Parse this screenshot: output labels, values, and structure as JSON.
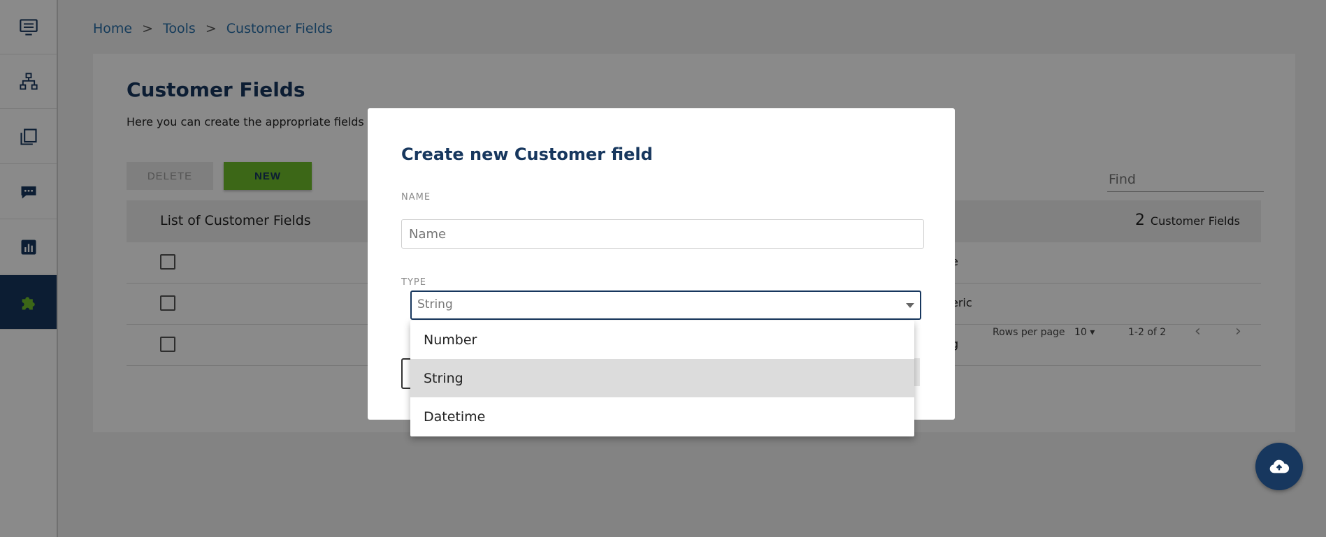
{
  "breadcrumb": {
    "home": "Home",
    "tools": "Tools",
    "current": "Customer Fields",
    "separator": ">"
  },
  "page": {
    "title": "Customer Fields",
    "description": "Here you can create the appropriate fields as",
    "delete_label": "DELETE",
    "new_label": "NEW",
    "find_placeholder": "Find"
  },
  "table": {
    "title": "List of Customer Fields",
    "count": "2",
    "count_label": "Customer Fields",
    "rows": [
      {
        "fragment": "e"
      },
      {
        "fragment": "eric"
      },
      {
        "fragment": "g"
      }
    ],
    "rows_per_page_label": "Rows per page",
    "rows_per_page": "10",
    "range": "1-2 of 2"
  },
  "sidebar": {
    "items": [
      {
        "icon": "monitor-list-icon"
      },
      {
        "icon": "hierarchy-icon"
      },
      {
        "icon": "copy-pages-icon"
      },
      {
        "icon": "chat-icon"
      },
      {
        "icon": "bar-chart-icon"
      },
      {
        "icon": "puzzle-icon",
        "active": true
      }
    ]
  },
  "modal": {
    "title": "Create new Customer field",
    "name_label": "NAME",
    "name_placeholder": "Name",
    "type_label": "TYPE",
    "type_value": "String",
    "options": [
      "Number",
      "String",
      "Datetime"
    ],
    "selected_option": "String"
  },
  "colors": {
    "brand": "#17375e",
    "accent": "#6fbf2c",
    "link": "#2a6fa8"
  }
}
